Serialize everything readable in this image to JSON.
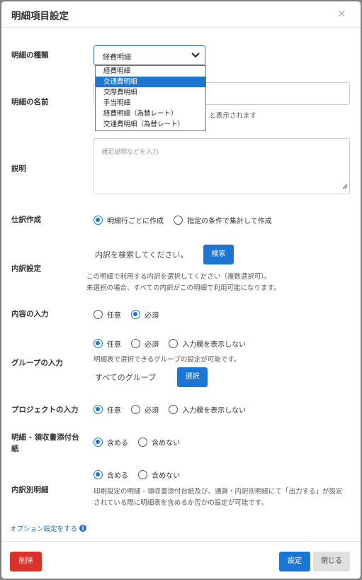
{
  "modal": {
    "title": "明細項目設定",
    "close_glyph": "×"
  },
  "kind": {
    "label": "明細の種類",
    "selected": "経費明細",
    "options": [
      "経費明細",
      "交通費明細",
      "交際費明細",
      "手当明細",
      "経費明細（為替レート）",
      "交通費明細（為替レート）"
    ],
    "highlighted_option": "交通費明細"
  },
  "name": {
    "label": "明細の名前",
    "hint_partial": "』と表示されます"
  },
  "description": {
    "label": "説明",
    "placeholder": "補足説明などを入力"
  },
  "journal": {
    "label": "仕訳作成",
    "options": [
      "明細行ごとに作成",
      "指定の条件で集計して作成"
    ],
    "selected": "明細行ごとに作成"
  },
  "breakdown": {
    "label": "内訳設定",
    "search_text": "内訳を検索してください。",
    "search_button": "検索",
    "help_line1": "この明細で利用する内訳を選択してください（複数選択可）。",
    "help_line2": "未選択の場合、すべての内訳がこの明細で利用可能になります。"
  },
  "content_input": {
    "label": "内容の入力",
    "options": [
      "任意",
      "必須"
    ],
    "selected": "必須"
  },
  "group_input": {
    "label": "グループの入力",
    "options": [
      "任意",
      "必須",
      "入力欄を表示しない"
    ],
    "selected": "任意",
    "help": "明細表で選択できるグループの設定が可能です。",
    "all_groups": "すべてのグループ",
    "select_button": "選択"
  },
  "project_input": {
    "label": "プロジェクトの入力",
    "options": [
      "任意",
      "必須",
      "入力欄を表示しない"
    ],
    "selected": "任意"
  },
  "receipt": {
    "label_line1": "明細 - 領収書添付台",
    "label_line2": "紙",
    "options": [
      "含める",
      "含めない"
    ],
    "selected": "含める"
  },
  "breakdown_detail": {
    "label": "内訳別明細",
    "options": [
      "含める",
      "含めない"
    ],
    "selected": "含める",
    "help_line1": "印刷設定の明細 - 領収書添付台紙及び、通貨・内訳別明細にて「出力する」が設定",
    "help_line2": "されている際に明細表を含めるか否かの設定が可能です。"
  },
  "options_link": {
    "label": "オプション設定をする",
    "icon": "info-icon"
  },
  "footer": {
    "delete": "削除",
    "save": "設定",
    "close": "閉じる"
  },
  "colors": {
    "primary": "#1e76d3",
    "danger": "#d9342b",
    "close_btn": "#e0e0e0"
  }
}
